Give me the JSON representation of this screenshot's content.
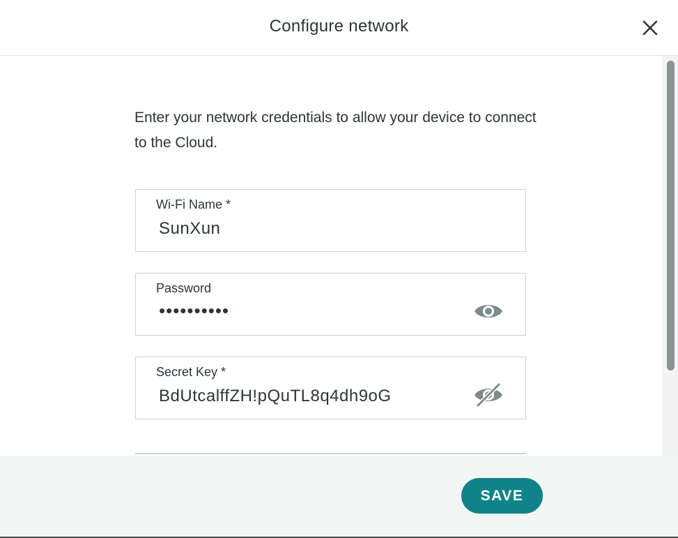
{
  "header": {
    "title": "Configure network",
    "close_icon": "close-icon"
  },
  "intro_text": "Enter your network credentials to allow your device to connect to the Cloud.",
  "fields": {
    "wifi_name": {
      "label": "Wi-Fi Name *",
      "value": "SunXun"
    },
    "password": {
      "label": "Password",
      "value": "••••••••••",
      "toggle_icon": "eye-icon"
    },
    "secret_key": {
      "label": "Secret Key *",
      "value": "BdUtcalffZH!pQuTL8q4dh9oG",
      "toggle_icon": "eye-off-icon"
    }
  },
  "footer": {
    "save_label": "SAVE"
  },
  "colors": {
    "accent": "#0f8387",
    "icon_gray": "#7f8b8b",
    "border": "#c9d2d2",
    "footer_bg": "#f4f6f6"
  }
}
